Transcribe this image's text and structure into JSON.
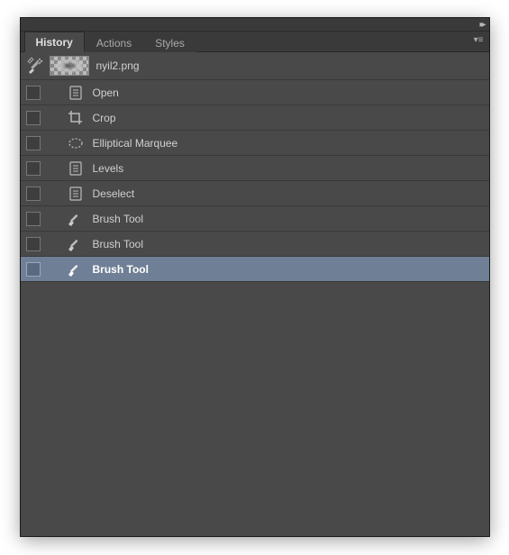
{
  "tabs": {
    "history": "History",
    "actions": "Actions",
    "styles": "Styles"
  },
  "document": {
    "filename": "nyil2.png"
  },
  "history": {
    "items": [
      {
        "icon": "file-icon",
        "label": "Open"
      },
      {
        "icon": "crop-icon",
        "label": "Crop"
      },
      {
        "icon": "marquee-icon",
        "label": "Elliptical Marquee"
      },
      {
        "icon": "file-icon",
        "label": "Levels"
      },
      {
        "icon": "file-icon",
        "label": "Deselect"
      },
      {
        "icon": "brush-icon",
        "label": "Brush Tool"
      },
      {
        "icon": "brush-icon",
        "label": "Brush Tool"
      },
      {
        "icon": "brush-icon",
        "label": "Brush Tool",
        "selected": true
      }
    ]
  },
  "colors": {
    "panel_bg": "#494949",
    "selected_bg": "#6f7f96",
    "text": "#d0d0d0"
  }
}
